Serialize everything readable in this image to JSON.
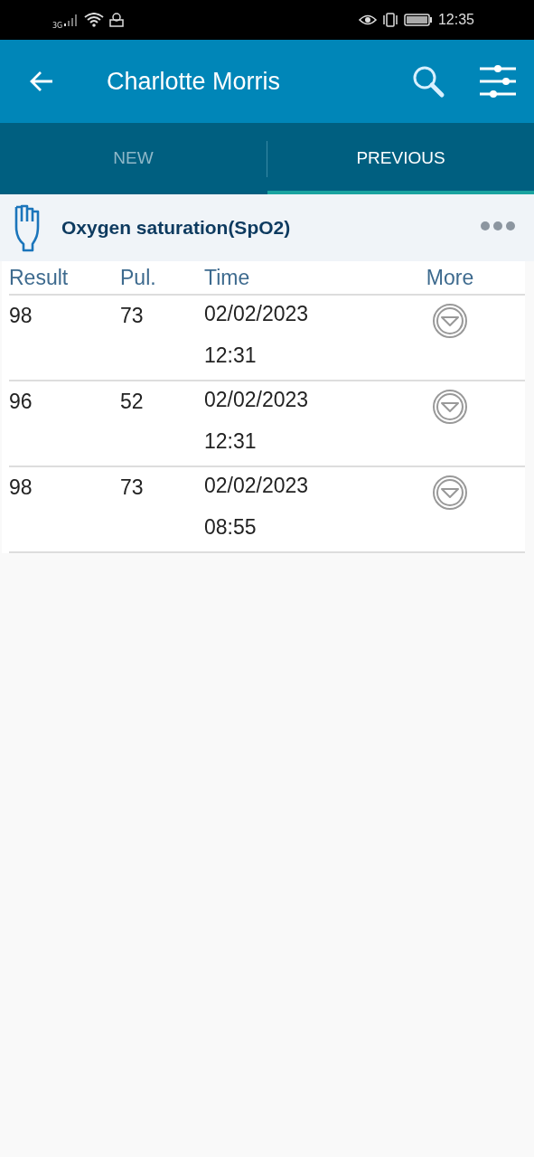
{
  "status_bar": {
    "network": "3G",
    "time": "12:35"
  },
  "app_bar": {
    "title": "Charlotte Morris"
  },
  "tabs": [
    {
      "label": "NEW",
      "selected": false
    },
    {
      "label": "PREVIOUS",
      "selected": true
    }
  ],
  "section": {
    "title": "Oxygen saturation(SpO2)"
  },
  "table": {
    "columns": [
      "Result",
      "Pul.",
      "Time",
      "More"
    ],
    "rows": [
      {
        "result": "98",
        "pulse": "73",
        "date": "02/02/2023",
        "time": "12:31"
      },
      {
        "result": "96",
        "pulse": "52",
        "date": "02/02/2023",
        "time": "12:31"
      },
      {
        "result": "98",
        "pulse": "73",
        "date": "02/02/2023",
        "time": "08:55"
      }
    ]
  }
}
